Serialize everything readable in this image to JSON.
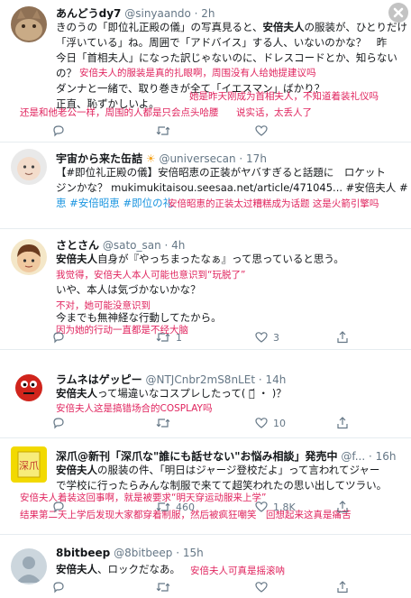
{
  "tweets": [
    {
      "name": "あんどうdy7",
      "handle": "@sinyaando",
      "time": "· 2h",
      "lines": [
        "きのうの「即位礼正殿の儀」の写真見ると、安倍夫人の服装が、ひとりだけ",
        "「浮いている」ね。周囲で「アドバイス」する人、いないのかな？　昨",
        "今日「首相夫人」になった訳じゃないのに、ドレスコードとか、知らない",
        "の？",
        "ダンナと一緒で、取り巻きが全て「イエスマン」ばかり？",
        "正直、恥ずかしいよ。"
      ],
      "trans": [
        "安倍夫人的服装是真的扎眼啊，周围没有人给她提建议吗",
        "她是昨天刚成为首相夫人，不知道着装礼仪吗",
        "还是和他老公一样，周围的人都是只会点头哈腰",
        "说实话，太丢人了"
      ]
    },
    {
      "name": "宇宙から来た缶詰",
      "handle": "@universecan",
      "time": "· 17h",
      "lines": [
        "【#即位礼正殿の儀】安倍昭恵の正装がヤバすぎると話題に　ロケット",
        "ジンかな？ mukimukitaisou.seesaa.net/article/471045... #安倍夫人 #",
        "恵 #安倍昭恵 #即位の礼"
      ],
      "trans": [
        "安倍昭恵的正装太过糟糕成为话题 这是火箭引擎吗"
      ]
    },
    {
      "name": "さとさん",
      "handle": "@sato_san",
      "time": "· 4h",
      "lines": [
        "安倍夫人自身が『やっちまったなぁ』って思っていると思う。",
        "いや、本人は気づかないかな？",
        "今までも無神経な行動してたから。"
      ],
      "trans": [
        "我觉得，安倍夫人本人可能也意识到“玩脱了”",
        "不对，她可能没意识到",
        "因为她的行动一直都是不经大脑"
      ],
      "reply": "",
      "retweet": "1",
      "like": "3"
    },
    {
      "name": "ラムネはゲッピー",
      "handle": "@NTJCnbr2mS8nLEt",
      "time": "· 14h",
      "lines": [
        "安倍夫人って場違いなコスプレしたって( ・᷄ ・ )？"
      ],
      "trans": [
        "安倍夫人这是搞错场合的COSPLAY吗"
      ],
      "reply": "",
      "retweet": "",
      "like": "10"
    },
    {
      "name": "深爪@新刊「深爪な\"誰にも話せない\"お悩み相談」発売中",
      "handle": "@f...",
      "time": "· 16h",
      "lines": [
        "安倍夫人の服装の件、「明日はジャージ登校だよ」って言われてジャー",
        "で学校に行ったらみんな制服で来てて超笑われたの思い出してツラい。"
      ],
      "trans": [
        "安倍夫人着装这回事啊，就是被要求“明天穿运动服来上学”",
        "结果第二天上学后发现大家都穿着制服，然后被疯狂嘲笑　回想起来这真是痛苦"
      ],
      "reply": "",
      "retweet": "460",
      "like": "1.8K"
    },
    {
      "name": "8bitbeep",
      "handle": "@8bitbeep",
      "time": "· 15h",
      "lines": [
        "安倍夫人、ロックだなあ。"
      ],
      "trans": [
        "安倍夫人可真是摇滚呐"
      ],
      "reply": "",
      "retweet": "",
      "like": ""
    }
  ]
}
